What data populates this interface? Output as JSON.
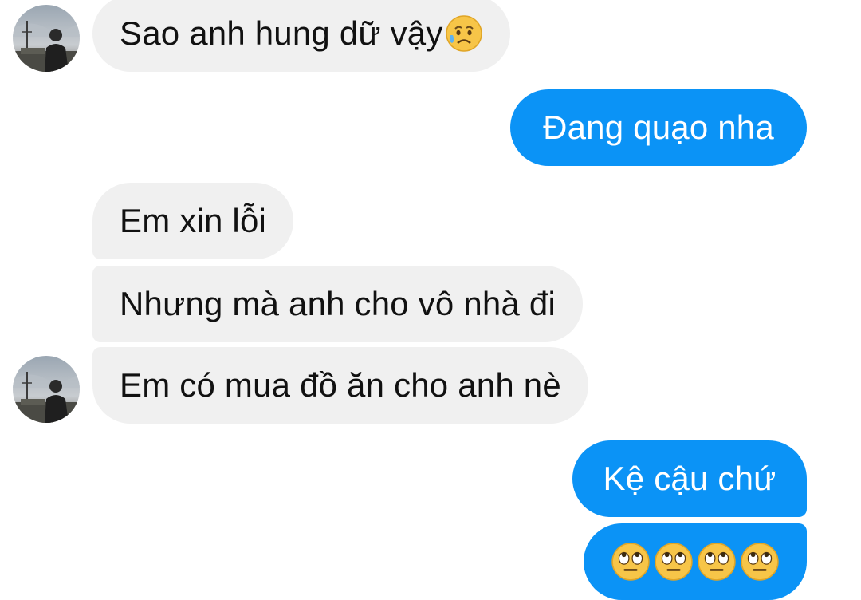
{
  "conversation": {
    "messages": [
      {
        "sender": "them",
        "text": "Sao anh hung dữ vậy",
        "emoji": "sad-relieved-face-icon"
      },
      {
        "sender": "me",
        "text": "Đang quạo nha"
      },
      {
        "sender": "them",
        "text": "Em xin lỗi"
      },
      {
        "sender": "them",
        "text": "Nhưng mà anh cho vô nhà đi"
      },
      {
        "sender": "them",
        "text": "Em có mua đồ ăn cho anh nè"
      },
      {
        "sender": "me",
        "text": "Kệ cậu chứ"
      },
      {
        "sender": "me",
        "emoji_count": 4,
        "emoji": "face-with-rolling-eyes-icon"
      }
    ]
  },
  "colors": {
    "incoming_bubble": "#f0f0f0",
    "outgoing_bubble": "#0b93f6",
    "incoming_text": "#111111",
    "outgoing_text": "#ffffff"
  }
}
